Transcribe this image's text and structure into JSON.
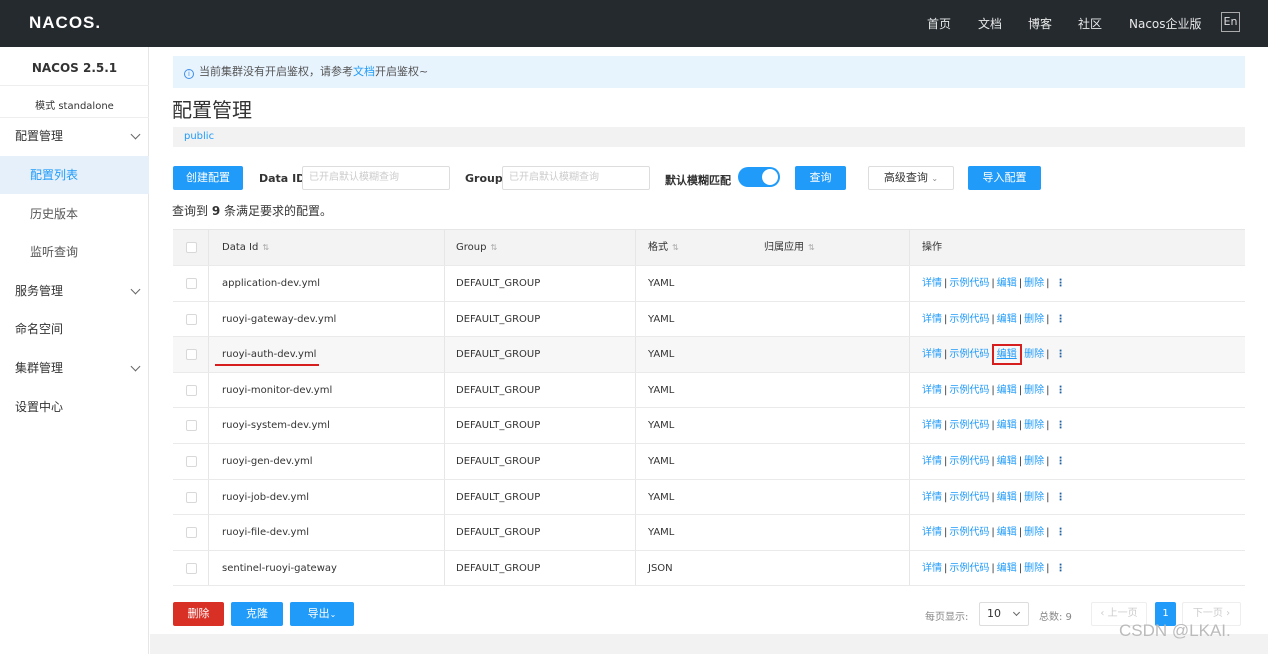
{
  "header": {
    "logo": "NACOS.",
    "nav": [
      "首页",
      "文档",
      "博客",
      "社区",
      "Nacos企业版"
    ],
    "lang": "En"
  },
  "sidebar": {
    "version": "NACOS 2.5.1",
    "mode": "模式 standalone",
    "items": [
      {
        "label": "配置管理",
        "expandable": true
      },
      {
        "label": "配置列表",
        "sub": true,
        "active": true
      },
      {
        "label": "历史版本",
        "sub": true
      },
      {
        "label": "监听查询",
        "sub": true
      },
      {
        "label": "服务管理",
        "expandable": true
      },
      {
        "label": "命名空间"
      },
      {
        "label": "集群管理",
        "expandable": true
      },
      {
        "label": "设置中心"
      }
    ]
  },
  "notice": {
    "text_before": "当前集群没有开启鉴权，请参考",
    "link": "文档",
    "text_after": "开启鉴权~"
  },
  "page_title": "配置管理",
  "namespace": "public",
  "toolbar": {
    "create_label": "创建配置",
    "dataid_label": "Data ID",
    "dataid_placeholder": "已开启默认模糊查询",
    "group_label": "Group",
    "group_placeholder": "已开启默认模糊查询",
    "fuzzy_label": "默认模糊匹配",
    "search_label": "查询",
    "advanced_label": "高级查询",
    "import_label": "导入配置"
  },
  "summary": {
    "prefix": "查询到 ",
    "count": "9",
    "suffix": " 条满足要求的配置。"
  },
  "table": {
    "headers": [
      "Data Id",
      "Group",
      "格式",
      "归属应用",
      "操作"
    ],
    "ops": [
      "详情",
      "示例代码",
      "编辑",
      "删除"
    ],
    "rows": [
      {
        "dataid": "application-dev.yml",
        "group": "DEFAULT_GROUP",
        "format": "YAML"
      },
      {
        "dataid": "ruoyi-gateway-dev.yml",
        "group": "DEFAULT_GROUP",
        "format": "YAML"
      },
      {
        "dataid": "ruoyi-auth-dev.yml",
        "group": "DEFAULT_GROUP",
        "format": "YAML"
      },
      {
        "dataid": "ruoyi-monitor-dev.yml",
        "group": "DEFAULT_GROUP",
        "format": "YAML"
      },
      {
        "dataid": "ruoyi-system-dev.yml",
        "group": "DEFAULT_GROUP",
        "format": "YAML"
      },
      {
        "dataid": "ruoyi-gen-dev.yml",
        "group": "DEFAULT_GROUP",
        "format": "YAML"
      },
      {
        "dataid": "ruoyi-job-dev.yml",
        "group": "DEFAULT_GROUP",
        "format": "YAML"
      },
      {
        "dataid": "ruoyi-file-dev.yml",
        "group": "DEFAULT_GROUP",
        "format": "YAML"
      },
      {
        "dataid": "sentinel-ruoyi-gateway",
        "group": "DEFAULT_GROUP",
        "format": "JSON"
      }
    ]
  },
  "footer": {
    "delete_label": "删除",
    "clone_label": "克隆",
    "export_label": "导出",
    "page_size_label": "每页显示:",
    "page_size": "10",
    "total_label": "总数: 9",
    "prev_label": "上一页",
    "current_page": "1",
    "next_label": "下一页"
  },
  "watermark": "CSDN @LKAI."
}
